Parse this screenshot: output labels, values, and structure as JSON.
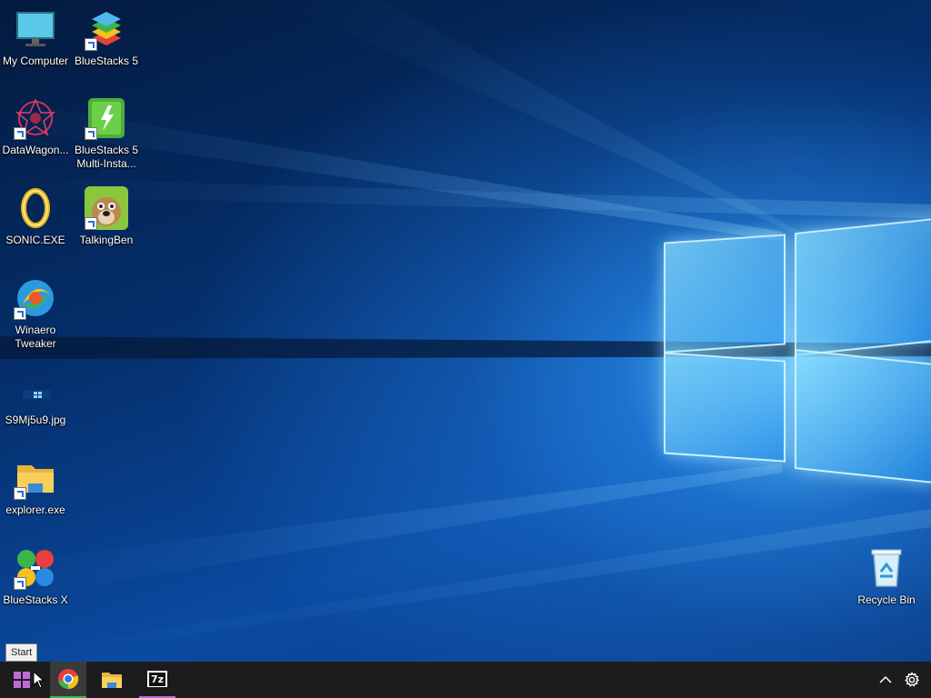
{
  "desktop": {
    "icons": [
      {
        "label": "My Computer",
        "icon": "monitor-icon"
      },
      {
        "label": "BlueStacks 5",
        "icon": "bluestacks-icon"
      },
      {
        "label": "DataWagon...",
        "icon": "datawagon-icon"
      },
      {
        "label": "BlueStacks 5 Multi-Insta...",
        "icon": "bluestacks-multi-instance-icon"
      },
      {
        "label": "SONIC.EXE",
        "icon": "gold-ring-icon"
      },
      {
        "label": "TalkingBen",
        "icon": "talking-ben-icon"
      },
      {
        "label": "Winaero Tweaker",
        "icon": "winaero-tweaker-icon"
      },
      {
        "label": "S9Mj5u9.jpg",
        "icon": "image-file-icon"
      },
      {
        "label": "explorer.exe",
        "icon": "folder-icon"
      },
      {
        "label": "BlueStacks X",
        "icon": "bluestacks-x-icon"
      },
      {
        "label": "Recycle Bin",
        "icon": "recycle-bin-icon"
      }
    ]
  },
  "tooltip": {
    "text": "Start"
  },
  "taskbar": {
    "items": [
      {
        "name": "Start",
        "icon": "windows-logo-icon"
      },
      {
        "name": "Google Chrome",
        "icon": "chrome-icon",
        "active": true
      },
      {
        "name": "File Explorer",
        "icon": "folder-icon"
      },
      {
        "name": "7-Zip",
        "icon": "7zip-icon",
        "label": "7z"
      }
    ],
    "tray": [
      {
        "name": "Show hidden icons",
        "icon": "chevron-up-icon"
      },
      {
        "name": "Settings",
        "icon": "gear-icon"
      }
    ]
  },
  "colors": {
    "taskbar": "#1c1c1c",
    "accent_green": "#3bb54a",
    "accent_purple": "#c06ad8"
  }
}
